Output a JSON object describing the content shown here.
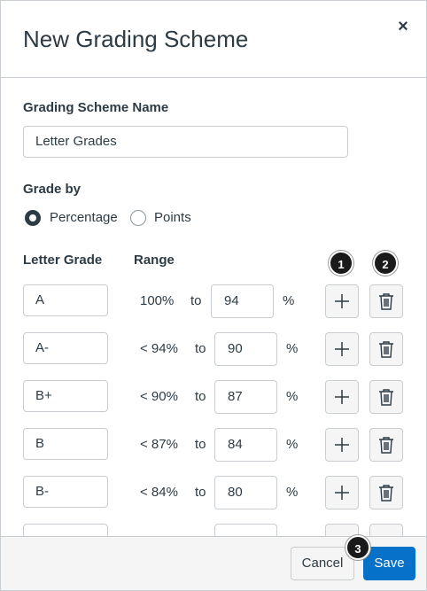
{
  "modal": {
    "title": "New Grading Scheme",
    "close_label": "×"
  },
  "form": {
    "name_label": "Grading Scheme Name",
    "name_value": "Letter Grades",
    "grade_by_label": "Grade by",
    "options": [
      {
        "label": "Percentage",
        "selected": true
      },
      {
        "label": "Points",
        "selected": false
      }
    ]
  },
  "table": {
    "headers": [
      "Letter Grade",
      "Range"
    ],
    "rows": [
      {
        "grade": "A",
        "low": "100%",
        "to": "to",
        "value": "94",
        "unit": "%"
      },
      {
        "grade": "A-",
        "low": "< 94%",
        "to": "to",
        "value": "90",
        "unit": "%"
      },
      {
        "grade": "B+",
        "low": "< 90%",
        "to": "to",
        "value": "87",
        "unit": "%"
      },
      {
        "grade": "B",
        "low": "< 87%",
        "to": "to",
        "value": "84",
        "unit": "%"
      },
      {
        "grade": "B-",
        "low": "< 84%",
        "to": "to",
        "value": "80",
        "unit": "%"
      }
    ]
  },
  "badges": [
    "1",
    "2",
    "3"
  ],
  "footer": {
    "cancel_label": "Cancel",
    "save_label": "Save"
  },
  "colors": {
    "primary": "#0770c8",
    "text": "#2d3b45",
    "border": "#c7cdd1",
    "badge": "#1a1a1a"
  },
  "icons": [
    "close-icon",
    "plus-icon",
    "trash-icon"
  ]
}
